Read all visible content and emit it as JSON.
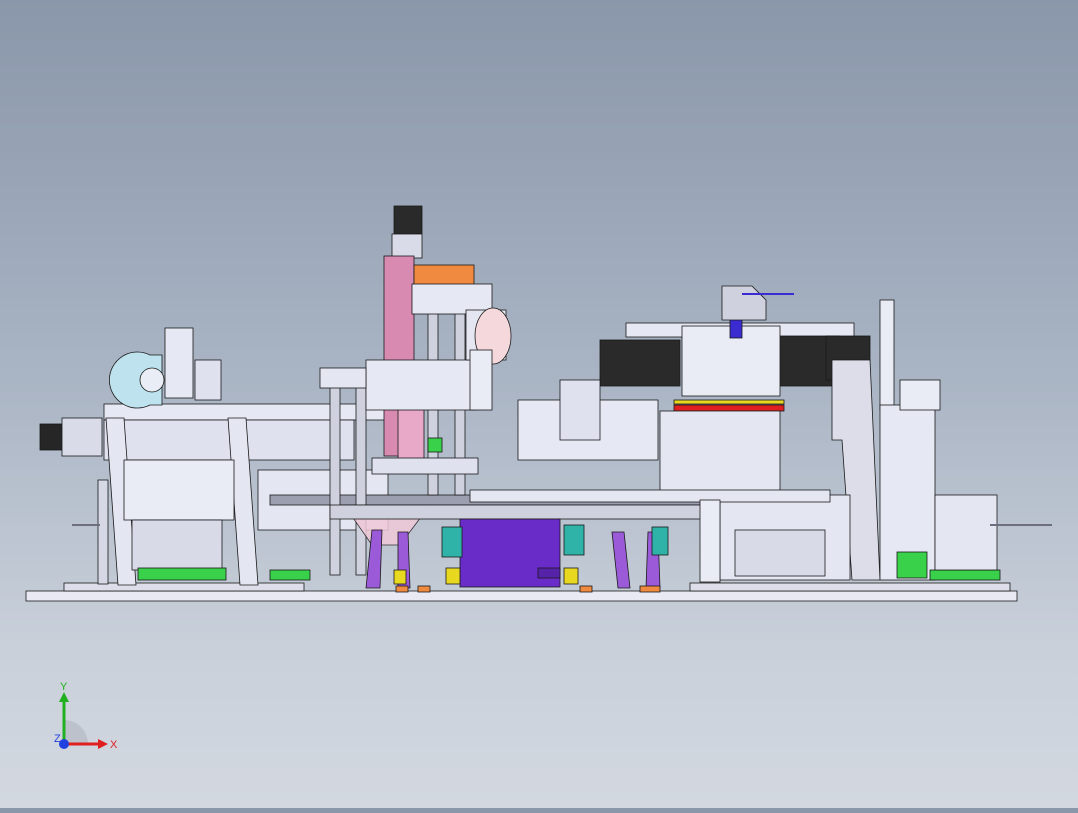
{
  "viewport": {
    "background_top": "#8a97aa",
    "background_bottom": "#d3d8e0",
    "model_colors": {
      "frame": "#e4e6f2",
      "edge": "#1a1a1a",
      "purple": "#6a2cc8",
      "pink": "#d98ab0",
      "teal": "#2fb3a8",
      "green": "#39d04a",
      "red": "#e02020",
      "yellow": "#e8d820",
      "orange": "#f08a40",
      "dark": "#2a2a2a",
      "light_blue": "#bfe3ee"
    }
  },
  "triad": {
    "x_label": "X",
    "y_label": "Y",
    "z_label": "Z",
    "x_color": "#e02020",
    "y_color": "#20b020",
    "z_color": "#2040e0"
  }
}
